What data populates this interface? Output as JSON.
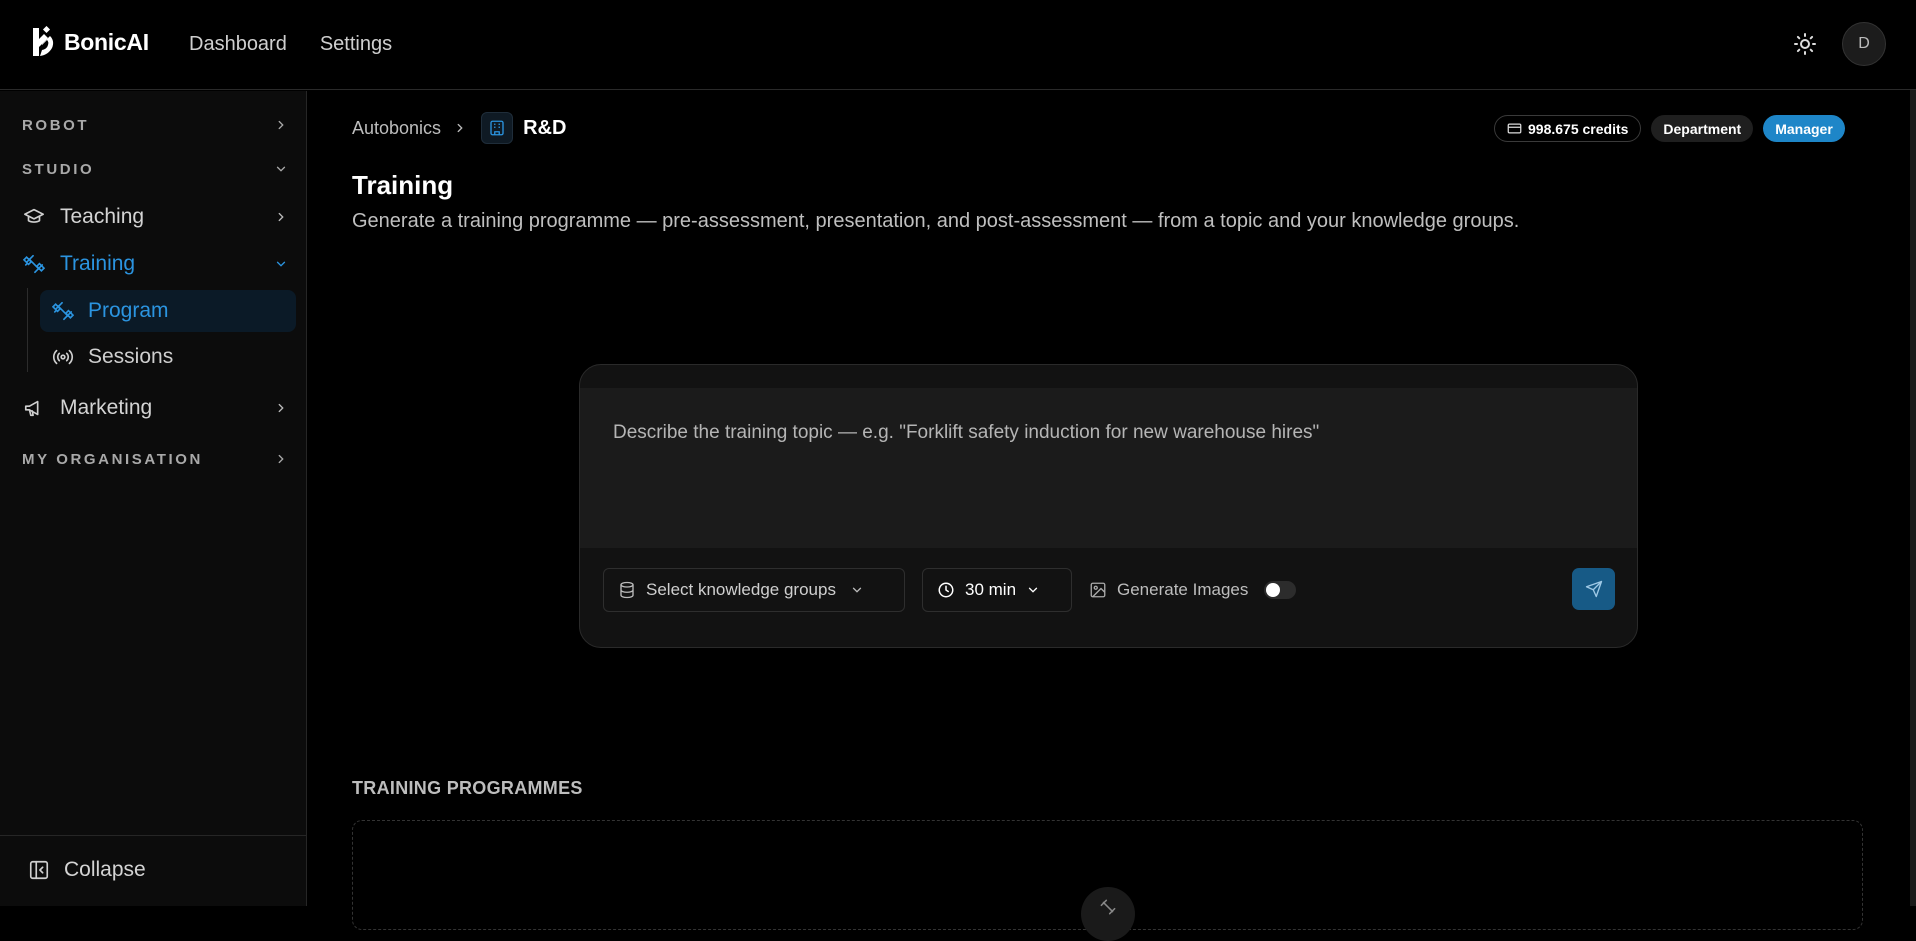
{
  "app": {
    "name": "BonicAI"
  },
  "topnav": {
    "items": [
      "Dashboard",
      "Settings"
    ]
  },
  "user": {
    "avatar_initial": "D"
  },
  "sidebar": {
    "sections": {
      "robot": "ROBOT",
      "studio": "STUDIO",
      "organisation": "MY ORGANISATION"
    },
    "items": {
      "teaching": "Teaching",
      "training": "Training",
      "program": "Program",
      "sessions": "Sessions",
      "marketing": "Marketing"
    },
    "collapse_label": "Collapse"
  },
  "breadcrumb": {
    "parent": "Autobonics",
    "current": "R&D"
  },
  "badges": {
    "credits": "998.675 credits",
    "department": "Department",
    "role": "Manager"
  },
  "page": {
    "title": "Training",
    "subtitle": "Generate a training programme — pre-assessment, presentation, and post-assessment — from a topic and your knowledge groups."
  },
  "composer": {
    "placeholder": "Describe the training topic — e.g. \"Forklift safety induction for new warehouse hires\"",
    "knowledge_groups_label": "Select knowledge groups",
    "duration_value": "30 min",
    "generate_images_label": "Generate Images",
    "generate_images_enabled": false
  },
  "programmes": {
    "section_title": "TRAINING PROGRAMMES"
  },
  "colors": {
    "accent": "#2b94e0",
    "manager_badge": "#1e86c8",
    "send_button": "#175a86"
  }
}
